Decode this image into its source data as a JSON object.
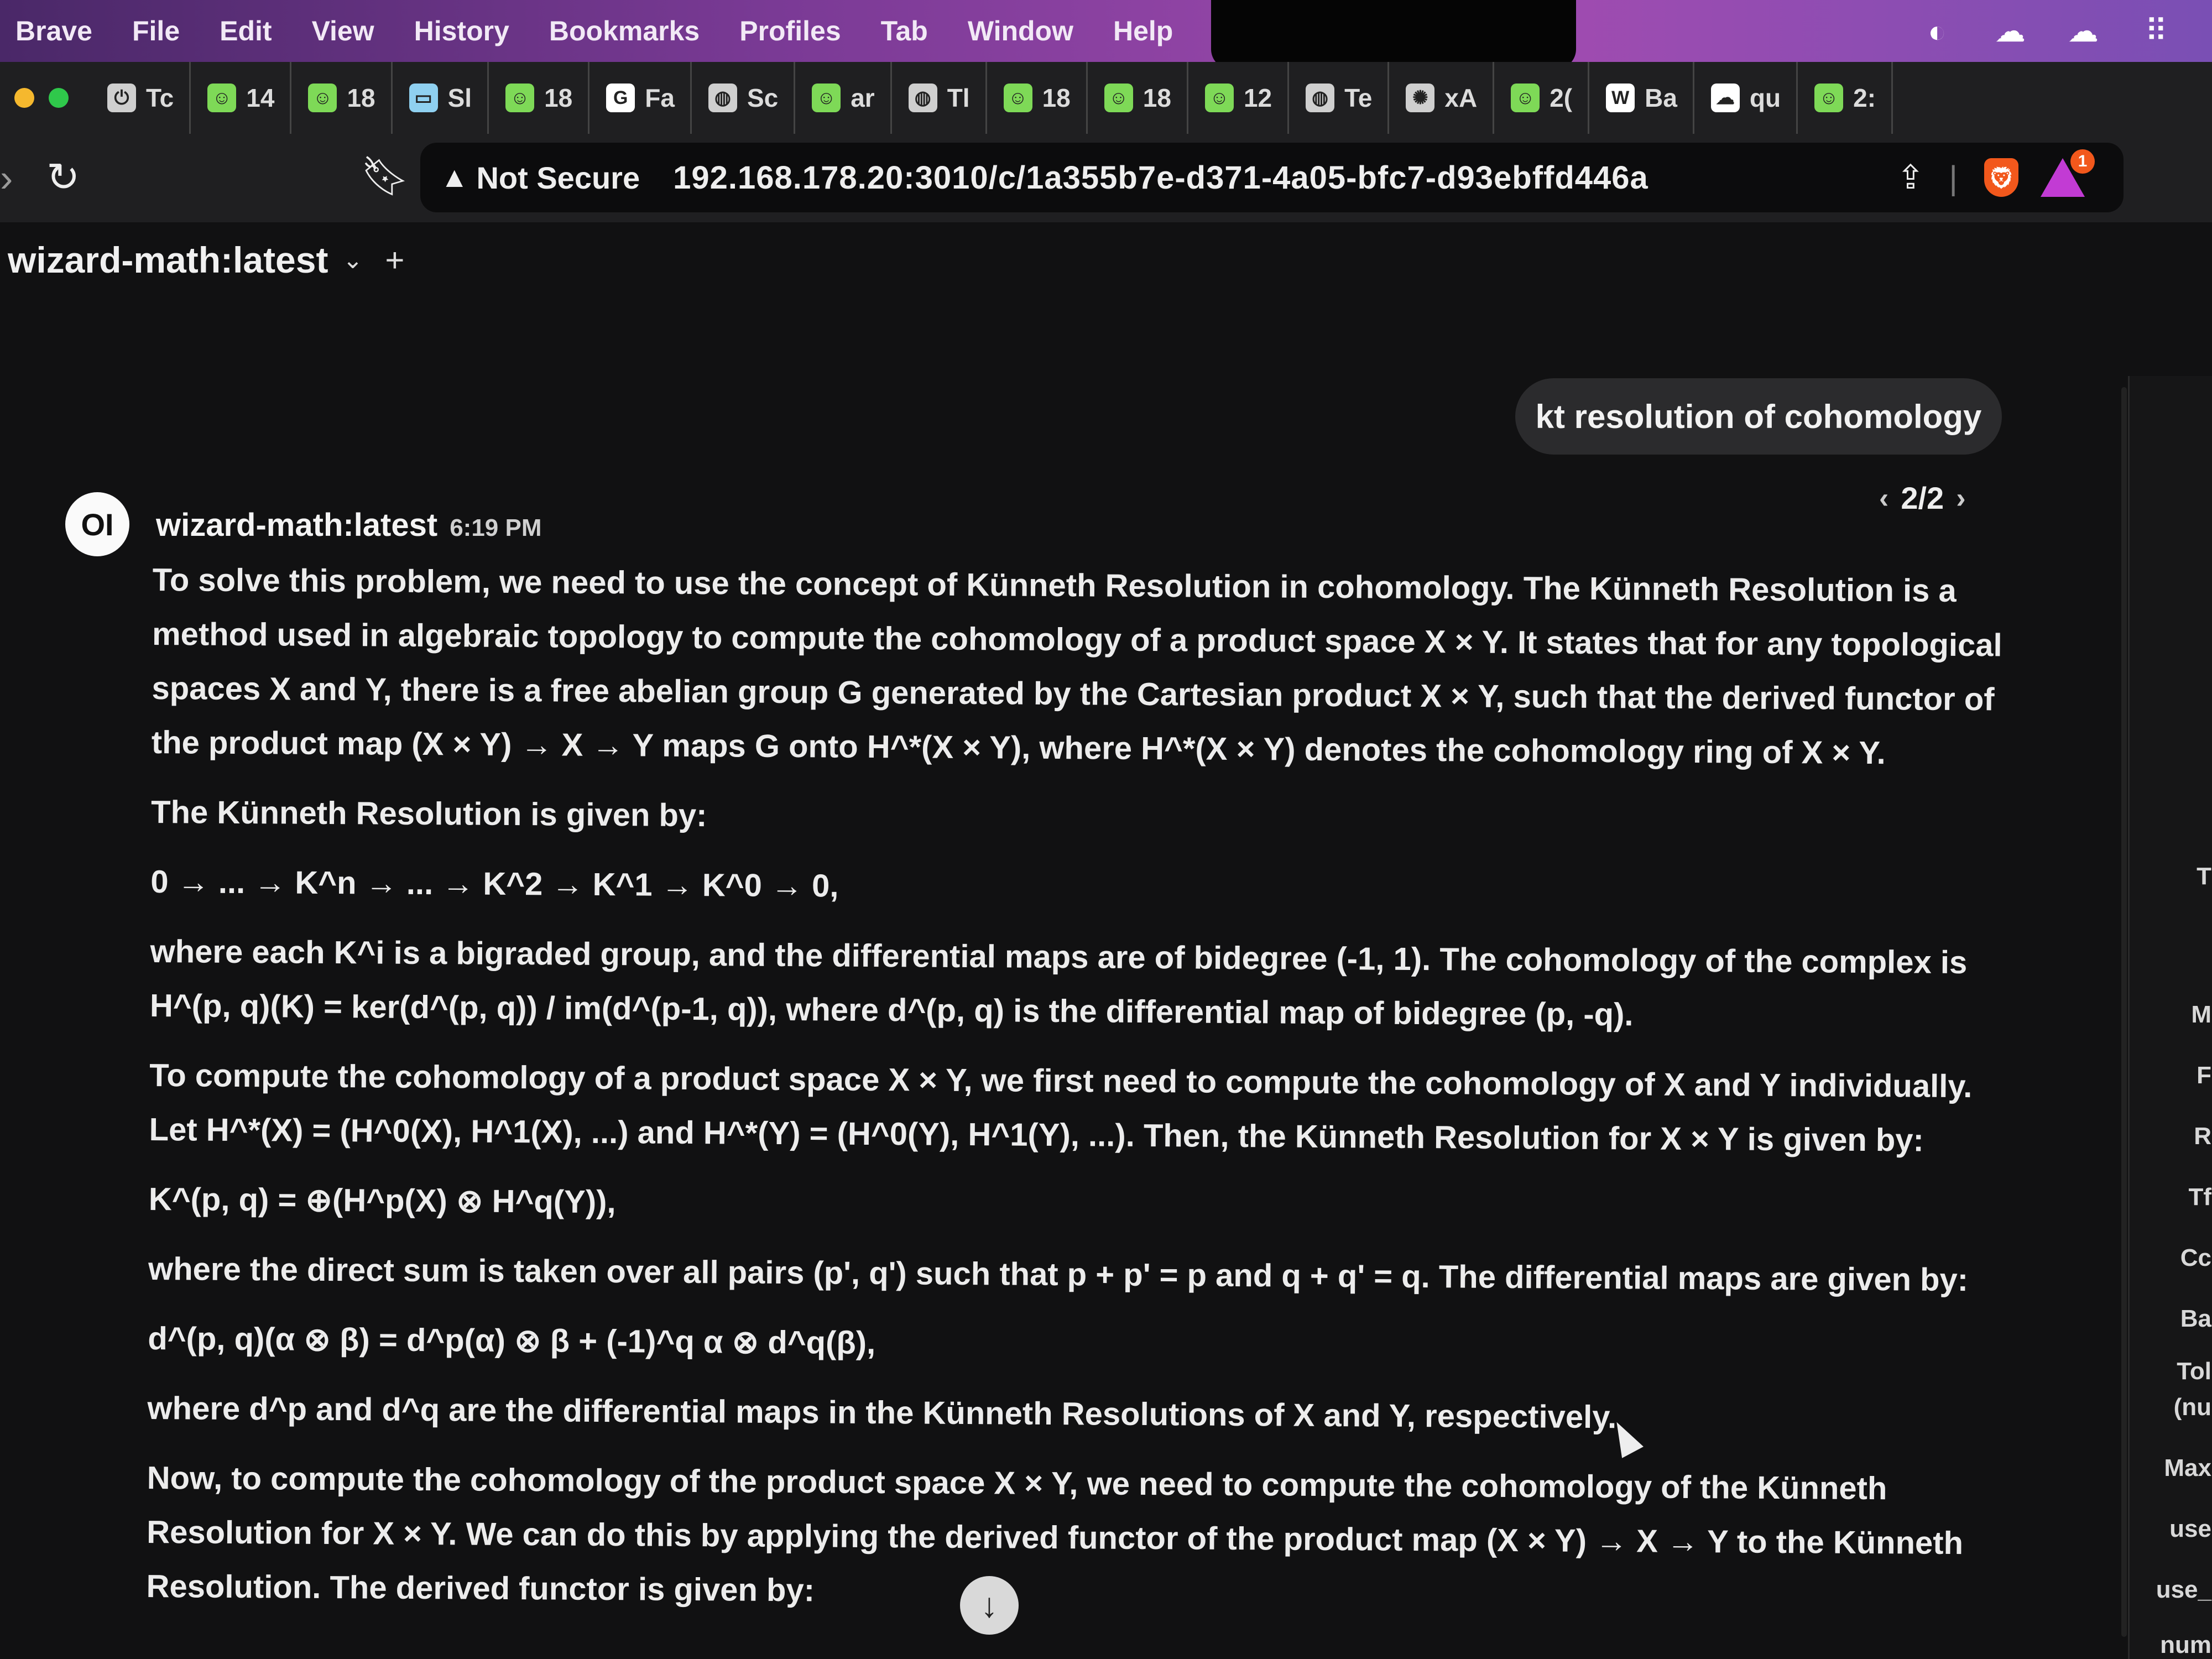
{
  "menubar": {
    "items": [
      "Brave",
      "File",
      "Edit",
      "View",
      "History",
      "Bookmarks",
      "Profiles",
      "Tab",
      "Window",
      "Help"
    ]
  },
  "colors": {
    "accent": "#a04bb0",
    "brave_orange": "#f2581c",
    "background": "#111112",
    "text": "#ececec"
  },
  "tabs": [
    {
      "label": "Tc",
      "icon": "power-icon",
      "color": "#cfcfcf"
    },
    {
      "label": "14",
      "icon": "smiley-icon",
      "color": "#7ed957"
    },
    {
      "label": "18",
      "icon": "smiley-icon",
      "color": "#7ed957"
    },
    {
      "label": "Sl",
      "icon": "landscape-icon",
      "color": "#8fd0f0"
    },
    {
      "label": "18",
      "icon": "smiley-icon",
      "color": "#7ed957"
    },
    {
      "label": "Fa",
      "icon": "google-icon",
      "color": "#ffffff"
    },
    {
      "label": "Sc",
      "icon": "globe-icon",
      "color": "#cfcfcf"
    },
    {
      "label": "ar",
      "icon": "smiley-icon",
      "color": "#7ed957"
    },
    {
      "label": "Tl",
      "icon": "globe-icon",
      "color": "#cfcfcf"
    },
    {
      "label": "18",
      "icon": "smiley-icon",
      "color": "#7ed957"
    },
    {
      "label": "18",
      "icon": "smiley-icon",
      "color": "#7ed957"
    },
    {
      "label": "12",
      "icon": "smiley-icon",
      "color": "#7ed957"
    },
    {
      "label": "Te",
      "icon": "globe-icon",
      "color": "#cfcfcf"
    },
    {
      "label": "xA",
      "icon": "openai-icon",
      "color": "#cfcfcf"
    },
    {
      "label": "2(",
      "icon": "smiley-icon",
      "color": "#7ed957"
    },
    {
      "label": "Ba",
      "icon": "wikipedia-icon",
      "color": "#ffffff"
    },
    {
      "label": "qu",
      "icon": "cloud-icon",
      "color": "#ffffff"
    },
    {
      "label": "2:",
      "icon": "smiley-icon",
      "color": "#7ed957"
    }
  ],
  "address_bar": {
    "security_label": "Not Secure",
    "url": "192.168.178.20:3010/c/1a355b7e-d371-4a05-bfc7-d93ebffd446a",
    "rewards_badge": "1"
  },
  "header": {
    "model_name": "wizard-math:latest",
    "chevron": "⌄",
    "plus": "+"
  },
  "chat": {
    "user_message": "kt resolution of cohomology",
    "pager": "2/2",
    "assistant": {
      "avatar": "OI",
      "name": "wizard-math:latest",
      "time": "6:19 PM",
      "paragraphs": [
        "To solve this problem, we need to use the concept of Künneth Resolution in cohomology. The Künneth Resolution is a method used in algebraic topology to compute the cohomology of a product space X × Y. It states that for any topological spaces X and Y, there is a free abelian group G generated by the Cartesian product X × Y, such that the derived functor of the product map (X × Y) → X → Y maps G onto H^*(X × Y), where H^*(X × Y) denotes the cohomology ring of X × Y.",
        "The Künneth Resolution is given by:",
        "0 → ... → K^n → ... → K^2 → K^1 → K^0 → 0,",
        "where each K^i is a bigraded group, and the differential maps are of bidegree (-1, 1). The cohomology of the complex is H^(p, q)(K) = ker(d^(p, q)) / im(d^(p-1, q)), where d^(p, q) is the differential map of bidegree (p, -q).",
        "To compute the cohomology of a product space X × Y, we first need to compute the cohomology of X and Y individually. Let H^*(X) = (H^0(X), H^1(X), ...) and H^*(Y) = (H^0(Y), H^1(Y), ...). Then, the Künneth Resolution for X × Y is given by:",
        "K^(p, q) = ⊕(H^p(X) ⊗ H^q(Y)),",
        "where the direct sum is taken over all pairs (p', q') such that p + p' = p and q + q' = q. The differential maps are given by:",
        "d^(p, q)(α ⊗ β) = d^p(α) ⊗ β + (-1)^q α ⊗ d^q(β),",
        "where d^p and d^q are the differential maps in the Künneth Resolutions of X and Y, respectively.",
        "Now, to compute the cohomology of the product space X × Y, we need to compute the cohomology of the Künneth Resolution for X × Y. We can do this by applying the derived functor of the product map (X × Y) → X → Y to the Künneth Resolution. The derived functor is given by:"
      ]
    }
  },
  "side_panel": {
    "items": [
      "T",
      "M",
      "F",
      "R",
      "Tf",
      "Cc",
      "Ba",
      "Tol",
      "(nu",
      "Max",
      "use",
      "use_",
      "num"
    ]
  }
}
